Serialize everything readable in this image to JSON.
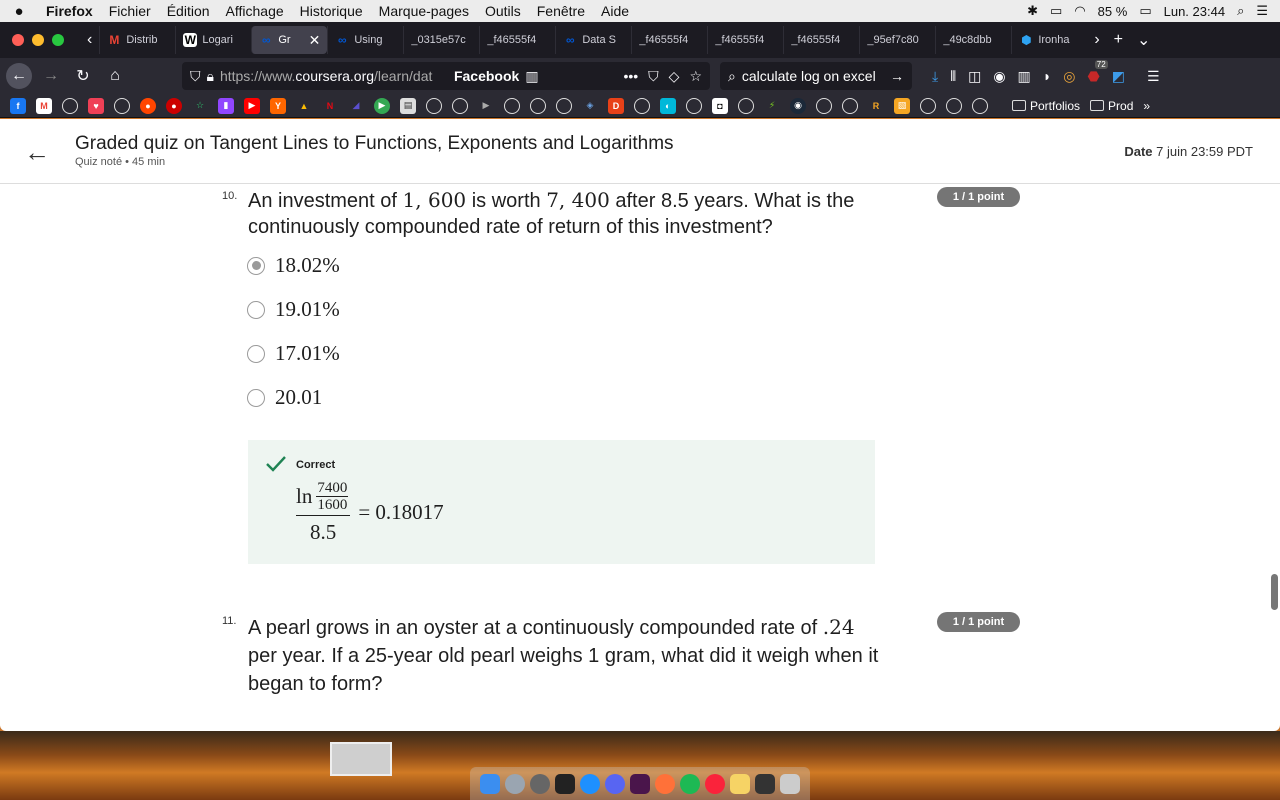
{
  "menubar": {
    "app": "Firefox",
    "items": [
      "Fichier",
      "Édition",
      "Affichage",
      "Historique",
      "Marque-pages",
      "Outils",
      "Fenêtre",
      "Aide"
    ],
    "battery": "85 %",
    "clock": "Lun. 23:44"
  },
  "tabs": [
    {
      "label": "Distrib",
      "icon": "gmail-icon",
      "color": "#ea4335",
      "glyph": "M"
    },
    {
      "label": "Logari",
      "icon": "wikipedia-icon",
      "color": "#ffffff",
      "glyph": "W"
    },
    {
      "label": "Gr",
      "icon": "coursera-icon",
      "color": "#0056d2",
      "glyph": "∞",
      "active": true
    },
    {
      "label": "Using",
      "icon": "coursera-icon",
      "color": "#0056d2",
      "glyph": "∞"
    },
    {
      "label": "_0315e57c",
      "icon": "",
      "color": "",
      "glyph": ""
    },
    {
      "label": "_f46555f4",
      "icon": "",
      "color": "",
      "glyph": ""
    },
    {
      "label": "Data S",
      "icon": "coursera-icon",
      "color": "#0056d2",
      "glyph": "∞"
    },
    {
      "label": "_f46555f4",
      "icon": "",
      "color": "",
      "glyph": ""
    },
    {
      "label": "_f46555f4",
      "icon": "",
      "color": "",
      "glyph": ""
    },
    {
      "label": "_f46555f4",
      "icon": "",
      "color": "",
      "glyph": ""
    },
    {
      "label": "_95ef7c80",
      "icon": "",
      "color": "",
      "glyph": ""
    },
    {
      "label": "_49c8dbb",
      "icon": "",
      "color": "",
      "glyph": ""
    },
    {
      "label": "Ironha",
      "icon": "ironhack-icon",
      "color": "#2ea3f2",
      "glyph": "⬢"
    }
  ],
  "nav": {
    "url_prefix": "https://www.",
    "url_domain": "coursera.org",
    "url_rest": "/learn/dat",
    "bookmark_label": "Facebook",
    "search_text": "calculate log on excel",
    "badge_count": "72"
  },
  "bookmarks": {
    "folders": [
      "Portfolios",
      "Prod"
    ]
  },
  "quiz": {
    "title": "Graded quiz on Tangent Lines to Functions, Exponents and Logarithms",
    "subtitle": "Quiz noté • 45  min",
    "due_label": "Date",
    "due_value": "7 juin 23:59 PDT"
  },
  "q10": {
    "number": "10.",
    "points": "1 / 1 point",
    "text_a": "An investment of ",
    "math_a": "1, 600",
    "text_b": " is worth ",
    "math_b": "7, 400",
    "text_c": " after 8.5 years. What is the continuously compounded rate of return of this investment?",
    "options": [
      "18.02%",
      "19.01%",
      "17.01%",
      "20.01"
    ],
    "selected_index": 0,
    "feedback_status": "Correct",
    "formula": {
      "ln": "ln",
      "inner_num": "7400",
      "inner_den": "1600",
      "den": "8.5",
      "rhs": "= 0.18017"
    }
  },
  "q11": {
    "number": "11.",
    "points": "1 / 1 point",
    "text_a": "A pearl grows in an oyster at a continuously compounded rate of ",
    "math_a": ".24",
    "text_b": " per year. If a 25-year old pearl weighs 1 gram, what did it weigh when it began to form?"
  },
  "colors": {
    "coursera_blue": "#0056d2",
    "correct_green": "#1f8354",
    "feedback_bg": "#eef5f1",
    "points_badge": "#757575"
  }
}
